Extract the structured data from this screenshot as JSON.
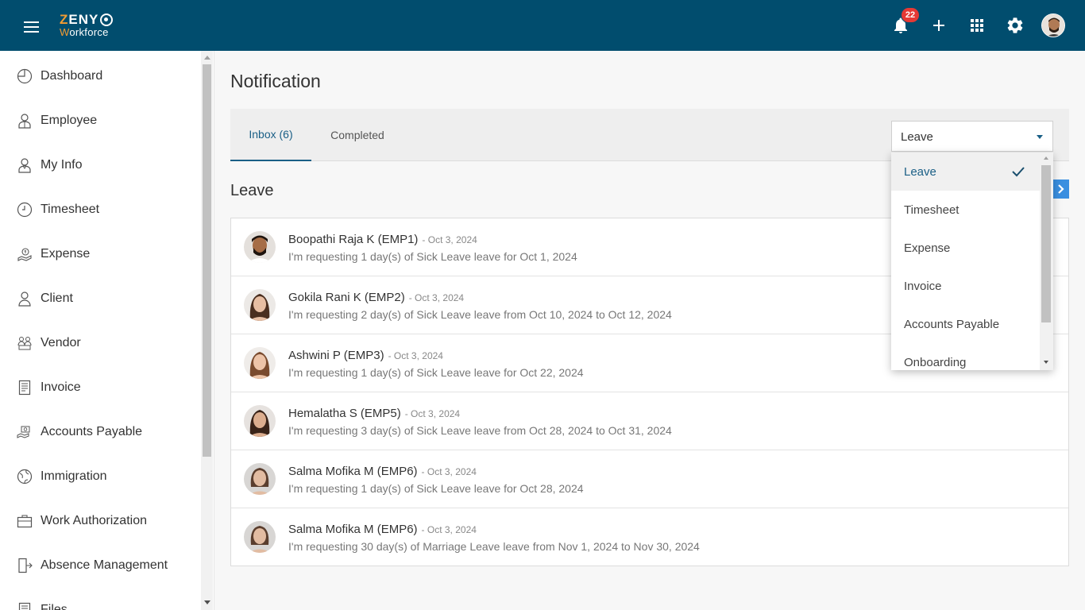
{
  "header": {
    "logo_line1_a": "Z",
    "logo_line1_b": "ENY",
    "logo_line2_a": "W",
    "logo_line2_b": "orkforce",
    "notification_count": "22",
    "icons": [
      "menu-icon",
      "bell-icon",
      "plus-icon",
      "apps-grid-icon",
      "gear-icon",
      "avatar"
    ]
  },
  "sidebar": {
    "items": [
      {
        "label": "Dashboard",
        "icon": "dashboard-icon"
      },
      {
        "label": "Employee",
        "icon": "employee-icon"
      },
      {
        "label": "My Info",
        "icon": "my-info-icon"
      },
      {
        "label": "Timesheet",
        "icon": "clock-icon"
      },
      {
        "label": "Expense",
        "icon": "expense-icon"
      },
      {
        "label": "Client",
        "icon": "client-icon"
      },
      {
        "label": "Vendor",
        "icon": "vendor-icon"
      },
      {
        "label": "Invoice",
        "icon": "invoice-icon"
      },
      {
        "label": "Accounts Payable",
        "icon": "accounts-payable-icon"
      },
      {
        "label": "Immigration",
        "icon": "globe-icon"
      },
      {
        "label": "Work Authorization",
        "icon": "briefcase-icon"
      },
      {
        "label": "Absence Management",
        "icon": "exit-door-icon"
      },
      {
        "label": "Files",
        "icon": "files-icon"
      }
    ]
  },
  "main": {
    "title": "Notification",
    "tabs": [
      {
        "label": "Inbox (6)",
        "active": true
      },
      {
        "label": "Completed",
        "active": false
      }
    ],
    "filter": {
      "selected": "Leave",
      "options": [
        "Leave",
        "Timesheet",
        "Expense",
        "Invoice",
        "Accounts Payable",
        "Onboarding"
      ]
    },
    "section_title": "Leave",
    "notifications": [
      {
        "name": "Boopathi Raja K (EMP1)",
        "date": "- Oct 3, 2024",
        "message": "I'm requesting 1 day(s) of Sick Leave leave for Oct 1, 2024"
      },
      {
        "name": "Gokila Rani K (EMP2)",
        "date": "- Oct 3, 2024",
        "message": "I'm requesting 2 day(s) of Sick Leave leave from Oct 10, 2024 to Oct 12, 2024"
      },
      {
        "name": "Ashwini P (EMP3)",
        "date": "- Oct 3, 2024",
        "message": "I'm requesting 1 day(s) of Sick Leave leave for Oct 22, 2024"
      },
      {
        "name": "Hemalatha S (EMP5)",
        "date": "- Oct 3, 2024",
        "message": "I'm requesting 3 day(s) of Sick Leave leave from Oct 28, 2024 to Oct 31, 2024"
      },
      {
        "name": "Salma Mofika M (EMP6)",
        "date": "- Oct 3, 2024",
        "message": "I'm requesting 1 day(s) of Sick Leave leave for Oct 28, 2024"
      },
      {
        "name": "Salma Mofika M (EMP6)",
        "date": "- Oct 3, 2024",
        "message": "I'm requesting 30 day(s) of Marriage Leave leave from Nov 1, 2024 to Nov 30, 2024"
      }
    ]
  },
  "colors": {
    "header_bg": "#014d6e",
    "accent": "#1a5f86",
    "logo_orange": "#f39c33",
    "badge_red": "#e53935",
    "next_button_blue": "#3a8fe0"
  }
}
